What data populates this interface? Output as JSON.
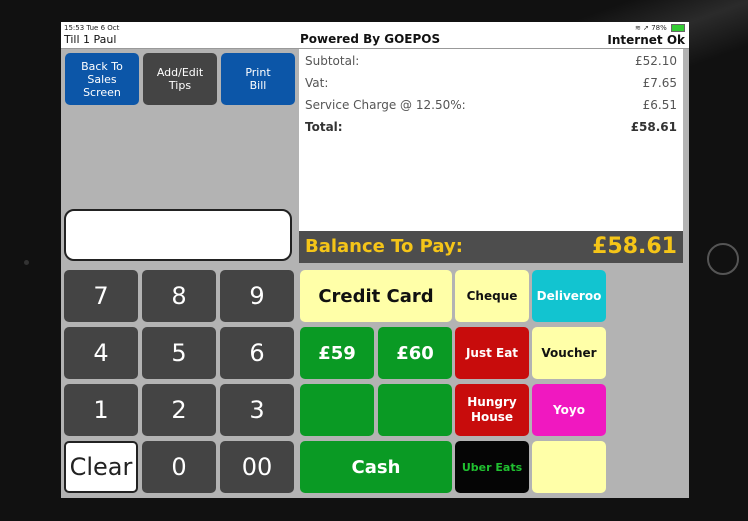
{
  "status_bar": {
    "time_date": "15:53  Tue 6 Oct",
    "till_user": "Till 1   Paul",
    "powered_by": "Powered By GOEPOS",
    "indicators": "78%",
    "connection": "Internet Ok"
  },
  "top_buttons": {
    "back": "Back To\nSales\nScreen",
    "tips": "Add/Edit\nTips",
    "print": "Print\nBill"
  },
  "display": {
    "value": ""
  },
  "keypad": {
    "k7": "7",
    "k8": "8",
    "k9": "9",
    "k4": "4",
    "k5": "5",
    "k6": "6",
    "k1": "1",
    "k2": "2",
    "k3": "3",
    "clear": "Clear",
    "k0": "0",
    "k00": "00"
  },
  "summary": {
    "subtotal_label": "Subtotal:",
    "subtotal_value": "£52.10",
    "vat_label": "Vat:",
    "vat_value": "£7.65",
    "service_label": "Service Charge @ 12.50%:",
    "service_value": "£6.51",
    "total_label": "Total:",
    "total_value": "£58.61"
  },
  "balance": {
    "label": "Balance To Pay:",
    "value": "£58.61"
  },
  "payments": {
    "credit_card": "Credit Card",
    "cheque": "Cheque",
    "deliveroo": "Deliveroo",
    "quick1": "£59",
    "quick2": "£60",
    "just_eat": "Just Eat",
    "voucher": "Voucher",
    "blank1": "",
    "blank2": "",
    "hungry_house": "Hungry\nHouse",
    "yoyo": "Yoyo",
    "cash": "Cash",
    "uber_eats": "Uber Eats",
    "blank3": ""
  },
  "colors": {
    "blue_button": "#0c56a8",
    "grey_button": "#444444",
    "balance_text": "#f5c518",
    "green": "#0a9a24",
    "red": "#c80c0c",
    "yellow": "#ffffa8",
    "cyan": "#12c4d0",
    "magenta": "#f018c0"
  }
}
